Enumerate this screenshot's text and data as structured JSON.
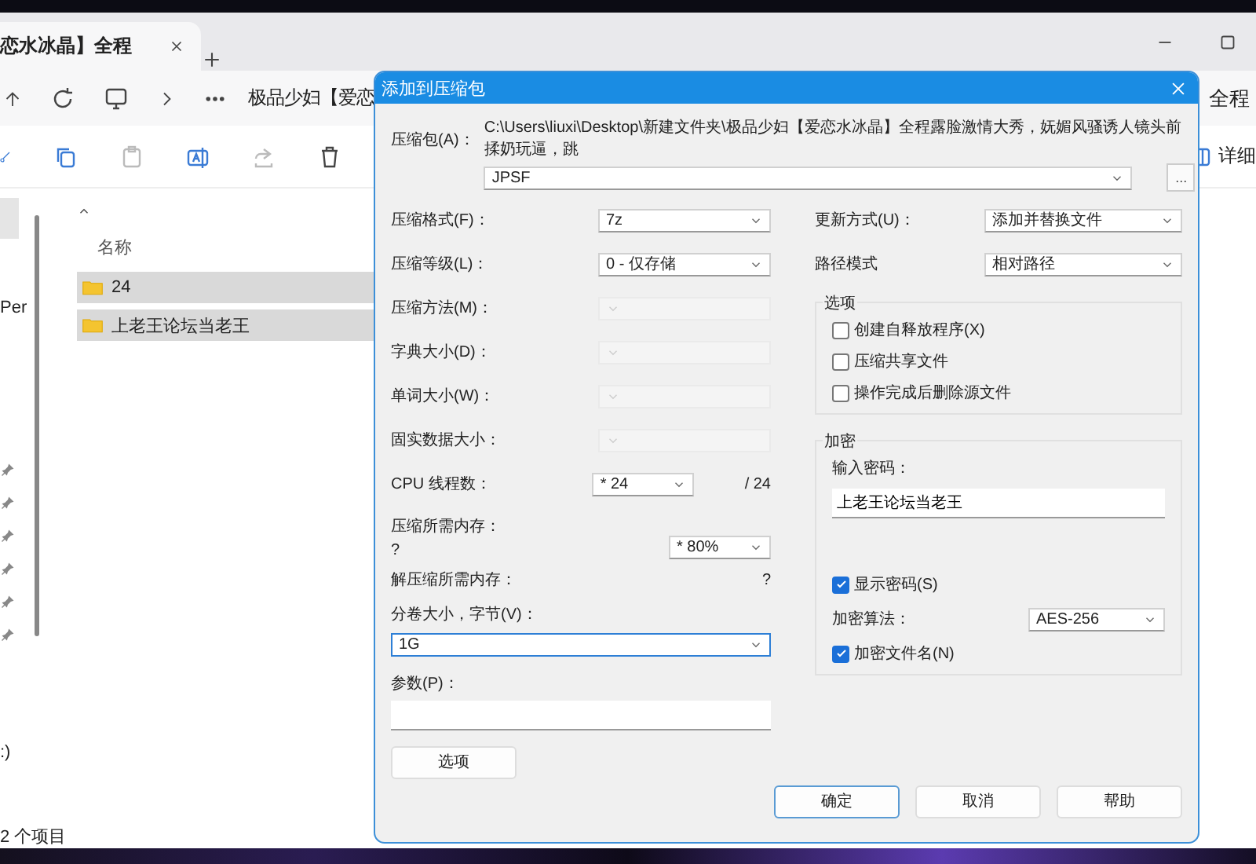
{
  "explorer": {
    "tab": {
      "title": "恋水冰晶】全程"
    },
    "breadcrumb": "极品少妇【爱恋",
    "breadcrumb_right": "全程",
    "toolbar_right": "详细",
    "nav_fragment": "Per",
    "nav_drive": ":)",
    "column_header": "名称",
    "files": [
      {
        "name": "24",
        "selected": true
      },
      {
        "name": "上老王论坛当老王",
        "selected": true
      }
    ],
    "status_bar": "2 个项目"
  },
  "dialog": {
    "title": "添加到压缩包",
    "archive": {
      "label": "压缩包(A)：",
      "path": "C:\\Users\\liuxi\\Desktop\\新建文件夹\\极品少妇【爱恋水冰晶】全程露脸激情大秀，妩媚风骚诱人镜头前揉奶玩逼，跳",
      "value": "JPSF",
      "browse": "..."
    },
    "left_settings": [
      {
        "label": "压缩格式(F)：",
        "value": "7z",
        "disabled": false
      },
      {
        "label": "压缩等级(L)：",
        "value": "0 - 仅存储",
        "disabled": false
      },
      {
        "label": "压缩方法(M)：",
        "disabled": true
      },
      {
        "label": "字典大小(D)：",
        "disabled": true
      },
      {
        "label": "单词大小(W)：",
        "disabled": true
      },
      {
        "label": "固实数据大小：",
        "disabled": true
      }
    ],
    "cpu": {
      "label": "CPU 线程数：",
      "value": "* 24",
      "total": "/ 24"
    },
    "memory": {
      "label": "压缩所需内存：",
      "hint": "?",
      "value": "* 80%"
    },
    "decompress": {
      "label": "解压缩所需内存：",
      "value": "?"
    },
    "volume": {
      "label": "分卷大小，字节(V)：",
      "value": "1G",
      "focused": true
    },
    "params": {
      "label": "参数(P)："
    },
    "options_button": "选项",
    "update": {
      "label": "更新方式(U)：",
      "value": "添加并替换文件"
    },
    "path_mode": {
      "label": "路径模式",
      "value": "相对路径"
    },
    "options_group": {
      "title": "选项",
      "checkboxes": [
        {
          "label": "创建自释放程序(X)",
          "checked": false
        },
        {
          "label": "压缩共享文件",
          "checked": false
        },
        {
          "label": "操作完成后删除源文件",
          "checked": false
        }
      ]
    },
    "encryption": {
      "title": "加密",
      "password_label": "输入密码：",
      "password": "上老王论坛当老王",
      "show_password": {
        "label": "显示密码(S)",
        "checked": true
      },
      "method_label": "加密算法：",
      "method": "AES-256",
      "encrypt_names": {
        "label": "加密文件名(N)",
        "checked": true
      }
    },
    "buttons": [
      {
        "label": "确定",
        "default": true
      },
      {
        "label": "取消",
        "default": false
      },
      {
        "label": "帮助",
        "default": false
      }
    ]
  }
}
